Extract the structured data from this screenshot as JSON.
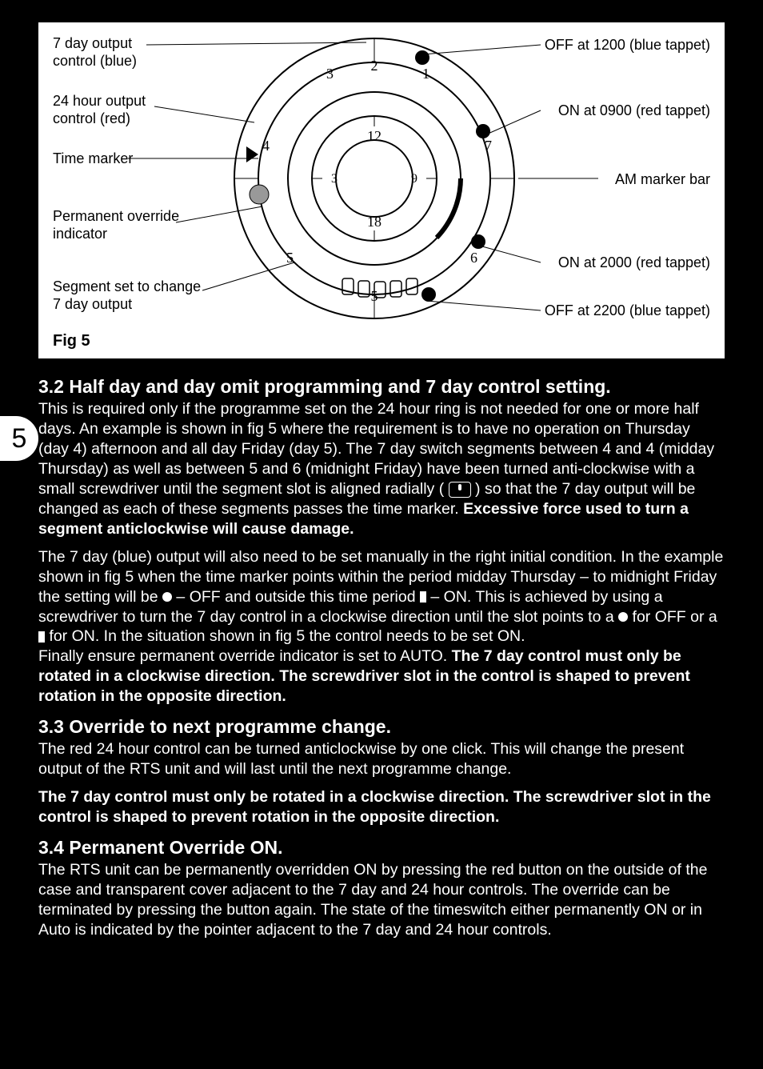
{
  "diagram": {
    "labels_left": [
      {
        "l1": "7 day output",
        "l2": "control (blue)"
      },
      {
        "l1": "24 hour output",
        "l2": "control (red)"
      },
      {
        "l1": "Time marker",
        "l2": ""
      },
      {
        "l1": "Permanent override",
        "l2": "indicator"
      },
      {
        "l1": "Segment set to change",
        "l2": "7 day output"
      }
    ],
    "labels_right": [
      "OFF at 1200 (blue tappet)",
      "ON at 0900 (red tappet)",
      "AM marker bar",
      "ON at 2000 (red tappet)",
      "OFF at 2200 (blue tappet)"
    ],
    "fig": "Fig 5"
  },
  "page_number": "5",
  "s32": {
    "heading": "3.2 Half day and day omit programming and 7 day control setting.",
    "p1a": "This is required only if the programme set on the 24 hour ring is not needed for one or more half days. An example is shown in fig 5 where the requirement is to have no operation on Thursday (day 4) afternoon and all day Friday (day 5). The 7 day switch segments between 4 and 4 (midday Thursday) as well as between 5 and 6 (midnight Friday) have been turned anti-clockwise with a small screwdriver until the segment slot is aligned radially (",
    "p1b": ") so that the 7 day output will be changed as each of these segments passes the time marker. ",
    "p1c_bold": "Excessive force used to turn a segment anticlockwise will cause damage.",
    "p2a": "The 7 day (blue) output will also need to be set manually in the right initial condition. In the example shown in fig 5 when the time marker points within the period midday Thursday – to midnight Friday the setting will be ",
    "p2b": " – OFF and outside this time period ",
    "p2c": " – ON. This is achieved by using a screwdriver to turn the 7 day control in a clockwise direction until the slot points to a ",
    "p2d": " for OFF or a ",
    "p2e": " for ON. In the situation shown in fig 5 the control needs to be set ON.",
    "p2f": "Finally ensure permanent override indicator is set to AUTO. ",
    "p2g_bold": "The 7 day control must only be rotated in a clockwise direction. The screwdriver slot in the control is shaped to prevent rotation in the opposite direction."
  },
  "s33": {
    "heading": "3.3 Override to next programme change.",
    "p1": "The red 24 hour control can be turned anticlockwise by one click. This will change the present output of the RTS unit and will last until the next programme change.",
    "p2_bold": "The 7 day control must only be rotated in a clockwise direction. The screwdriver slot in the control is shaped to prevent rotation in the opposite direction."
  },
  "s34": {
    "heading": "3.4 Permanent Override ON.",
    "p1": "The RTS unit can be permanently overridden ON by pressing the red button on the outside of the case and transparent cover adjacent to the 7 day and 24 hour controls. The override can be terminated by pressing the button again. The state of the timeswitch either permanently ON or in Auto is indicated by the pointer adjacent to the 7 day and 24 hour controls."
  }
}
